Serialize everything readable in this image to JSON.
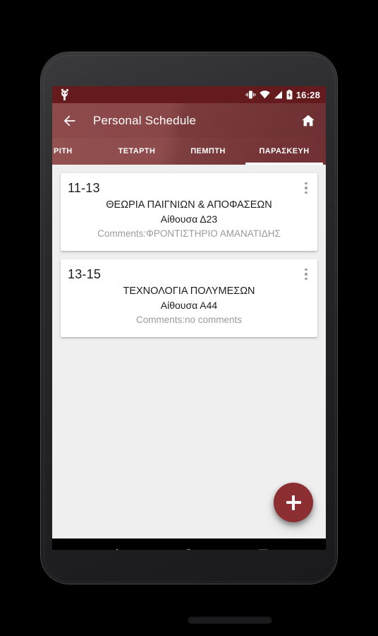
{
  "status_bar": {
    "notification_icon": "app-notification-icon",
    "vibrate_icon": "vibrate-icon",
    "wifi_icon": "wifi-icon",
    "signal_icon": "signal-icon",
    "battery_icon": "battery-charging-icon",
    "time": "16:28"
  },
  "appbar": {
    "back_icon": "back-arrow-icon",
    "title": "Personal Schedule",
    "home_icon": "home-icon"
  },
  "tabs": [
    {
      "label": "ΡΙΤΗ",
      "active": false
    },
    {
      "label": "ΤΕΤΑΡΤΗ",
      "active": false
    },
    {
      "label": "ΠΕΜΠΤΗ",
      "active": false
    },
    {
      "label": "ΠΑΡΑΣΚΕΥΗ",
      "active": true
    }
  ],
  "cards": [
    {
      "time": "11-13",
      "course": "ΘΕΩΡΙΑ ΠΑΙΓΝΙΩΝ & ΑΠΟΦΑΣΕΩΝ",
      "room": "Αίθουσα Δ23",
      "comments": "Comments:ΦΡΟΝΤΙΣΤΗΡΙΟ ΑΜΑΝΑΤΙΔΗΣ"
    },
    {
      "time": "13-15",
      "course": "ΤΕΧΝΟΛΟΓΙΑ ΠΟΛΥΜΕΣΩΝ",
      "room": "Αίθουσα Α44",
      "comments": "Comments:no comments"
    }
  ],
  "fab": {
    "icon": "plus-icon",
    "label": "Add"
  },
  "navbar": {
    "back": "nav-back-icon",
    "home": "nav-home-icon",
    "recents": "nav-recents-icon"
  },
  "colors": {
    "status_bar": "#651a1d",
    "app_bar": "#7b3b3d",
    "tab_bar": "#7d3e40",
    "fab": "#8b2f33",
    "content_bg": "#efefef",
    "card_bg": "#ffffff",
    "comment_text": "#9b9b9b",
    "accent_indicator": "#ffffff"
  }
}
